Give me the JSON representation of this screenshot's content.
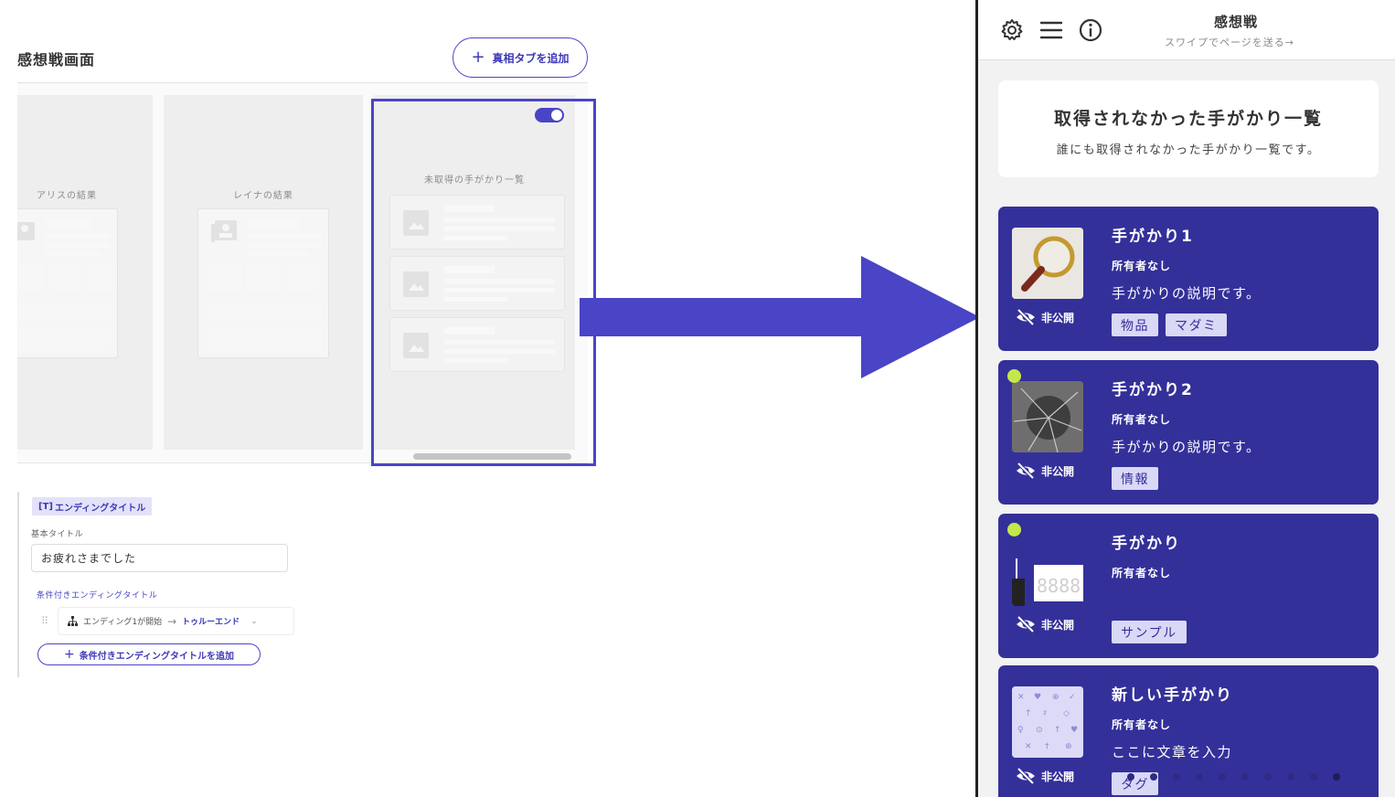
{
  "editor": {
    "page_title": "感想戦画面",
    "add_truth_tab_label": "真相タブを追加",
    "columns": [
      {
        "title": "アリスの結果"
      },
      {
        "title": "レイナの結果"
      },
      {
        "title": "未取得の手がかり一覧",
        "enabled": true
      }
    ],
    "ending": {
      "section_label": "エンディングタイトル",
      "basic_title_label": "基本タイトル",
      "basic_title_value": "お疲れさまでした",
      "conditional_label": "条件付きエンディングタイトル",
      "conditions": [
        {
          "condition": "エンディング1が開始",
          "target": "トゥルーエンド"
        }
      ],
      "add_conditional_label": "条件付きエンディングタイトルを追加"
    }
  },
  "preview": {
    "header_title": "感想戦",
    "header_subtitle": "スワイプでページを送る→",
    "intro_title": "取得されなかった手がかり一覧",
    "intro_desc": "誰にも取得されなかった手がかり一覧です。",
    "clues": [
      {
        "name": "手がかり1",
        "owner": "所有者なし",
        "desc": "手がかりの説明です。",
        "visibility": "非公開",
        "tags": [
          "物品",
          "マダミ"
        ],
        "is_new": false,
        "image": "magnifying-glass"
      },
      {
        "name": "手がかり2",
        "owner": "所有者なし",
        "desc": "手がかりの説明です。",
        "visibility": "非公開",
        "tags": [
          "情報"
        ],
        "is_new": true,
        "image": "cracked-surface"
      },
      {
        "name": "手がかり",
        "owner": "所有者なし",
        "desc": "",
        "visibility": "非公開",
        "tags": [
          "サンプル"
        ],
        "is_new": true,
        "image": "digital-display"
      },
      {
        "name": "新しい手がかり",
        "owner": "所有者なし",
        "desc": "ここに文章を入力",
        "visibility": "非公開",
        "tags": [
          "タグ"
        ],
        "is_new": false,
        "image": "icon-pattern"
      }
    ],
    "pager": {
      "count": 10,
      "active_index": 9
    }
  },
  "colors": {
    "accent": "#4a44c6",
    "card": "#34309a",
    "new_dot": "#c4e84a"
  }
}
